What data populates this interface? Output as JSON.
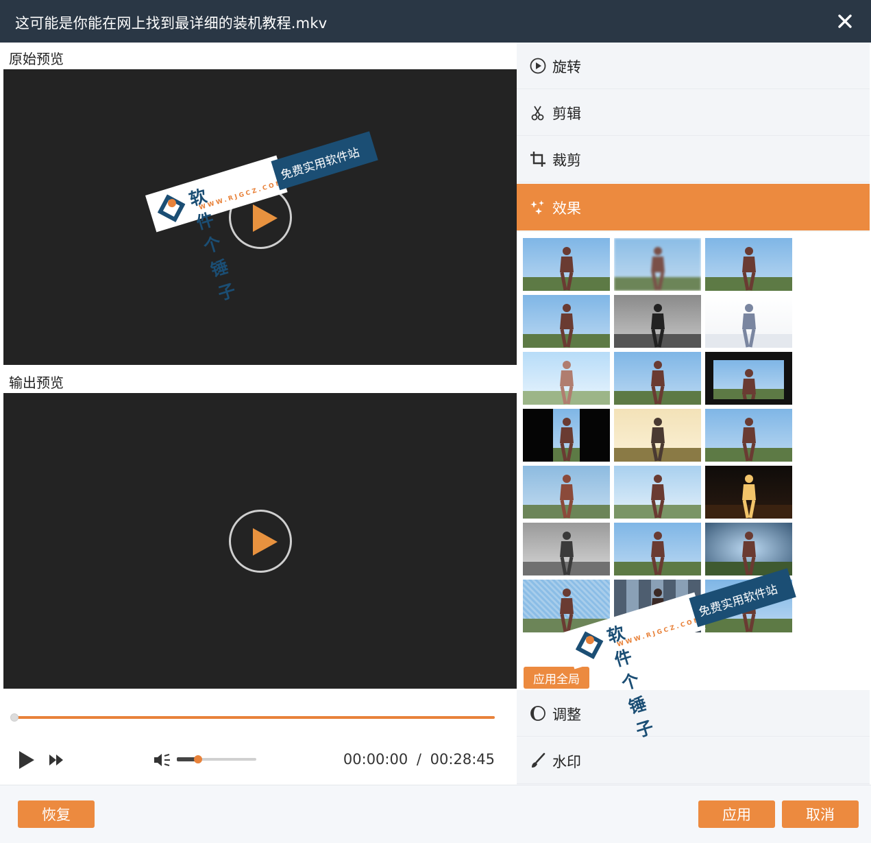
{
  "window": {
    "title": "这可能是你能在网上找到最详细的装机教程.mkv"
  },
  "preview": {
    "original_label": "原始预览",
    "output_label": "输出预览"
  },
  "player": {
    "progress": 0.0,
    "volume": 0.25,
    "current_time": "00:00:00",
    "separator": "/",
    "total_time": "00:28:45"
  },
  "menu": {
    "items": [
      {
        "label": "旋转",
        "icon": "rotate-icon"
      },
      {
        "label": "剪辑",
        "icon": "scissors-icon"
      },
      {
        "label": "裁剪",
        "icon": "crop-icon"
      },
      {
        "label": "效果",
        "icon": "sparkle-icon",
        "active": true
      },
      {
        "label": "调整",
        "icon": "adjust-icon"
      },
      {
        "label": "水印",
        "icon": "brush-icon"
      }
    ]
  },
  "effects": {
    "apply_all_label": "应用全局",
    "thumbnails": [
      "normal",
      "blur",
      "normal",
      "normal",
      "grayscale",
      "sketch",
      "overexpose",
      "normal",
      "framed",
      "narrow",
      "warm",
      "normal",
      "pixelate",
      "noise",
      "neon",
      "emboss",
      "normal",
      "vignette",
      "texture",
      "tiles",
      "normal"
    ]
  },
  "watermark": {
    "brand": "软件个锤子",
    "slogan": "免费实用软件站",
    "url": "WWW.RJGCZ.COM"
  },
  "footer": {
    "reset_label": "恢复",
    "apply_label": "应用",
    "cancel_label": "取消"
  },
  "colors": {
    "accent": "#ec8a3f",
    "titlebar": "#2a3745",
    "video_bg": "#232323"
  }
}
